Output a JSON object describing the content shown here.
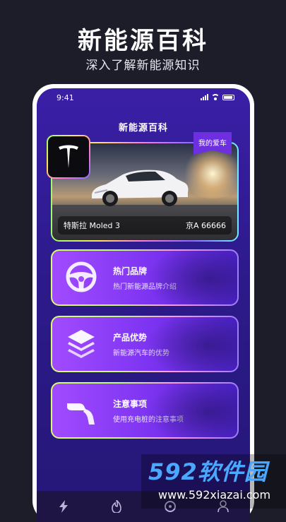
{
  "promo": {
    "title": "新能源百科",
    "subtitle": "深入了解新能源知识"
  },
  "status_bar": {
    "time": "9:41"
  },
  "app": {
    "title": "新能源百科"
  },
  "car_card": {
    "badge": "我的爱车",
    "brand_logo_icon": "tesla-logo",
    "car_name": "特斯拉  Moled 3",
    "plate": "京A 66666"
  },
  "menu": [
    {
      "icon": "steering-wheel-icon",
      "title": "热门品牌",
      "desc": "热门新能源品牌介绍"
    },
    {
      "icon": "layers-icon",
      "title": "产品优势",
      "desc": "新能源汽车的优势"
    },
    {
      "icon": "charger-plug-icon",
      "title": "注意事项",
      "desc": "使用充电桩的注意事项"
    }
  ],
  "bottom_nav": [
    {
      "icon": "lightning-icon"
    },
    {
      "icon": "flame-icon"
    },
    {
      "icon": "steering-icon"
    },
    {
      "icon": "user-icon"
    }
  ],
  "watermark": {
    "main": "592软件园",
    "sub": "www.592xiazai.com"
  },
  "colors": {
    "background": "#1d1d29",
    "screen": "#3a1fa6",
    "accent": "#9bff6a"
  }
}
